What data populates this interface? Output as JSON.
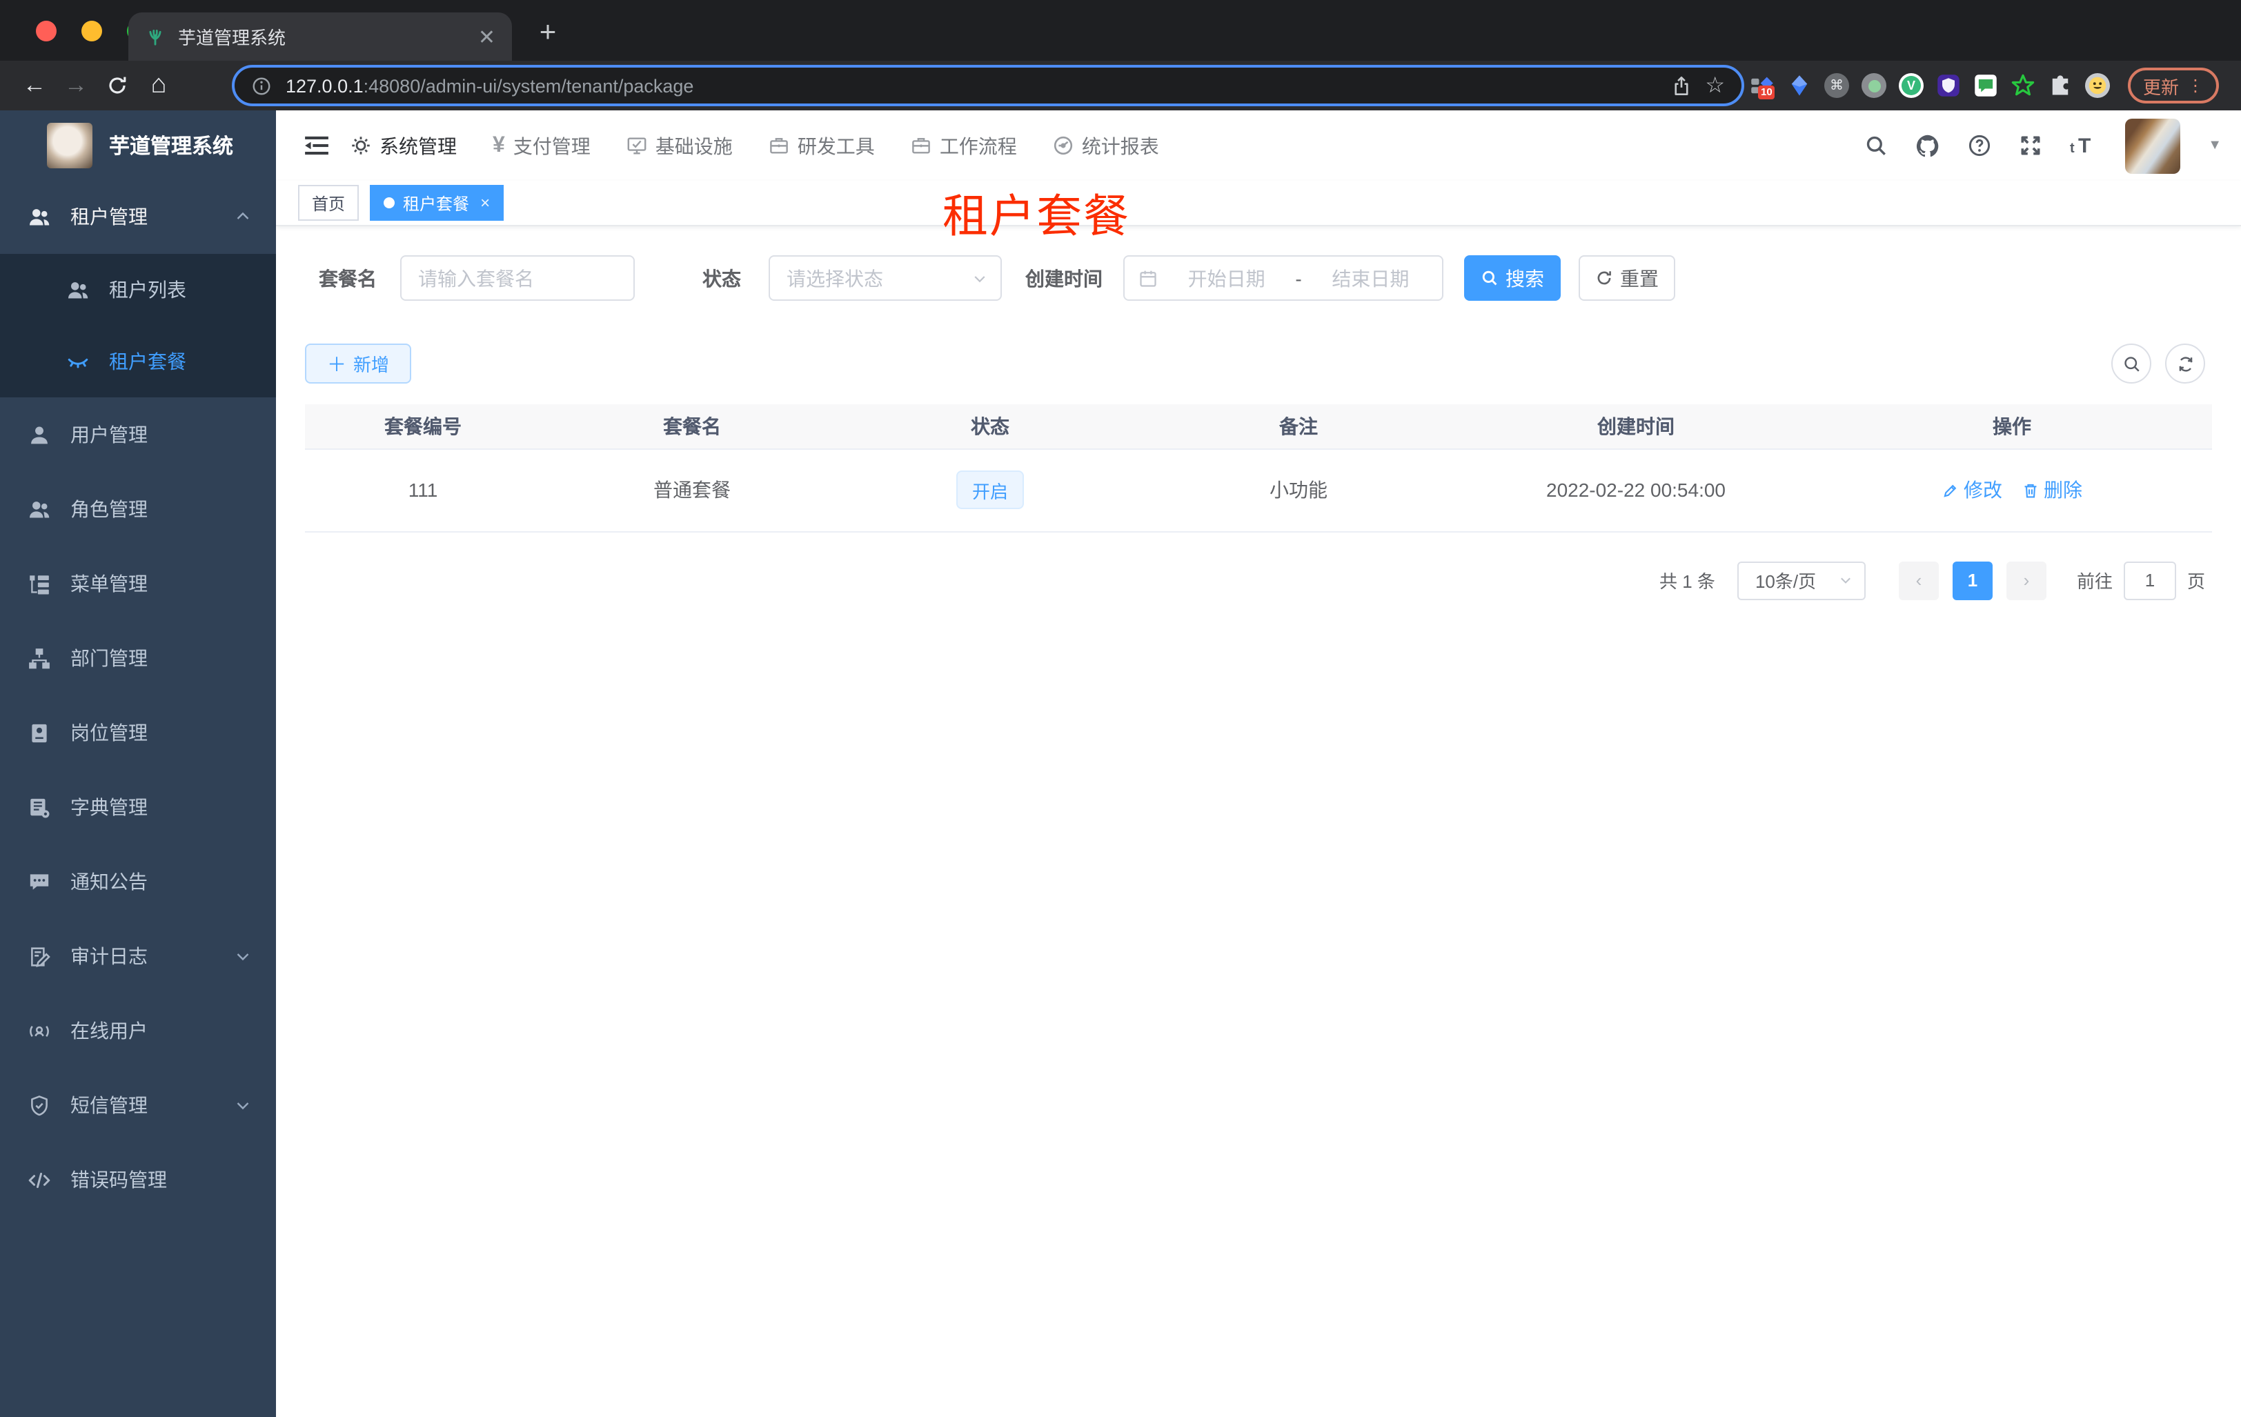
{
  "browser": {
    "tab_title": "芋道管理系统",
    "url_host": "127.0.0.1",
    "url_rest": ":48080/admin-ui/system/tenant/package",
    "ext_badge": "10",
    "update_label": "更新"
  },
  "header": {
    "logo_title": "芋道管理系统",
    "nav": [
      {
        "label": "系统管理"
      },
      {
        "label": "支付管理"
      },
      {
        "label": "基础设施"
      },
      {
        "label": "研发工具"
      },
      {
        "label": "工作流程"
      },
      {
        "label": "统计报表"
      }
    ]
  },
  "sidebar": {
    "group_tenant": "租户管理",
    "sub_tenant_list": "租户列表",
    "sub_tenant_package": "租户套餐",
    "items": [
      {
        "label": "用户管理"
      },
      {
        "label": "角色管理"
      },
      {
        "label": "菜单管理"
      },
      {
        "label": "部门管理"
      },
      {
        "label": "岗位管理"
      },
      {
        "label": "字典管理"
      },
      {
        "label": "通知公告"
      },
      {
        "label": "审计日志"
      },
      {
        "label": "在线用户"
      },
      {
        "label": "短信管理"
      },
      {
        "label": "错误码管理"
      }
    ]
  },
  "tags": {
    "home": "首页",
    "active": "租户套餐"
  },
  "overlay_title": "租户套餐",
  "filters": {
    "name_label": "套餐名",
    "name_placeholder": "请输入套餐名",
    "status_label": "状态",
    "status_placeholder": "请选择状态",
    "date_label": "创建时间",
    "date_start": "开始日期",
    "date_sep": "-",
    "date_end": "结束日期",
    "search_label": "搜索",
    "reset_label": "重置"
  },
  "toolbar": {
    "add_label": "新增"
  },
  "table": {
    "columns": [
      "套餐编号",
      "套餐名",
      "状态",
      "备注",
      "创建时间",
      "操作"
    ],
    "row": {
      "id": "111",
      "name": "普通套餐",
      "status": "开启",
      "remark": "小功能",
      "created_at": "2022-02-22 00:54:00",
      "edit_label": "修改",
      "delete_label": "删除"
    }
  },
  "pagination": {
    "total": "共 1 条",
    "page_size": "10条/页",
    "current": "1",
    "goto_label": "前往",
    "goto_value": "1",
    "unit_label": "页"
  },
  "colors": {
    "primary": "#409eff",
    "sidebar_bg": "#304156",
    "submenu_bg": "#1f2d3d",
    "annotation_red": "#fb2d00"
  }
}
